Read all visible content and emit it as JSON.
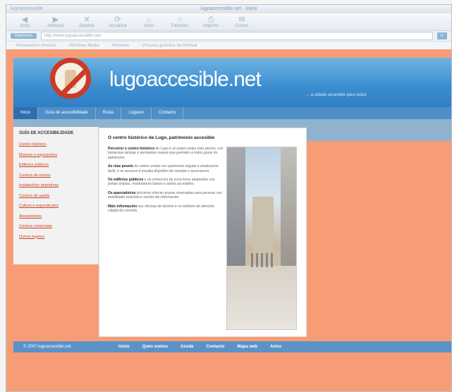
{
  "browser": {
    "title": "lugoaccessible.net · Inicio",
    "window_label": "lugoaccessible",
    "toolbar": [
      {
        "glyph": "◀",
        "label": "Atrás"
      },
      {
        "glyph": "▶",
        "label": "Adelante"
      },
      {
        "glyph": "✕",
        "label": "Detener"
      },
      {
        "glyph": "⟳",
        "label": "Actualizar"
      },
      {
        "glyph": "⌂",
        "label": "Inicio"
      },
      {
        "glyph": "☆",
        "label": "Favoritos"
      },
      {
        "glyph": "⎙",
        "label": "Imprimir"
      },
      {
        "glyph": "✉",
        "label": "Correo"
      }
    ],
    "address_label": "Dirección",
    "address_value": "http://www.lugoaccessible.net/",
    "go_label": "Ir",
    "bookmarks": [
      "Personalizar vínculos",
      "Windows Media",
      "Windows",
      "Vínculos gratuitos de Hotmail"
    ]
  },
  "site": {
    "name": "lugoaccesible.net",
    "tagline": "... a cidade accesible para todos",
    "nav": [
      "Inicio",
      "Guía de accesibilidade",
      "Rutas",
      "Lugares",
      "Contacto"
    ],
    "sidebar_title": "GUÍA DE ACCESIBILIDADE",
    "sidebar_links": [
      "Centro histórico",
      "Museos e exposicións",
      "Edificios públicos",
      "Centros de ensino",
      "Instalacións deportivas",
      "Centros de saúde",
      "Cultura e espectáculos",
      "Aloxamentos",
      "Centros comerciais",
      "Outros lugares"
    ],
    "article_title": "O centro histórico de Lugo, patrimonio accesible",
    "article_paragraphs": [
      {
        "strong": "Percorrer o centro histórico",
        "text": " de Lugo é un paseo polas rúas peonís, con beirarrúas amplas e pendentes suaves que permiten a todos gozar do patrimonio."
      },
      {
        "strong": "As rúas peonís",
        "text": " do centro contan con pavimento regular e sinalización táctil, e os accesos á muralla dispoñen de ramplas e ascensores."
      },
      {
        "strong": "Os edificios públicos",
        "text": " e os comercios da zona foron adaptados con portas amplas, mostradores baixos e aseos accesibles."
      },
      {
        "strong": "Os aparcadoiros",
        "text": " próximos ofrecen prazas reservadas para persoas con mobilidade reducida e servizo de información."
      },
      {
        "strong": "Máis información",
        "text": " nas oficinas de turismo e no teléfono de atención cidadá do concello."
      }
    ],
    "footer": {
      "copyright": "© 2007 lugoaccesible.net",
      "links": [
        "Inicio",
        "Quen somos",
        "Axuda",
        "Contacto",
        "Mapa web",
        "Aviso"
      ]
    }
  }
}
